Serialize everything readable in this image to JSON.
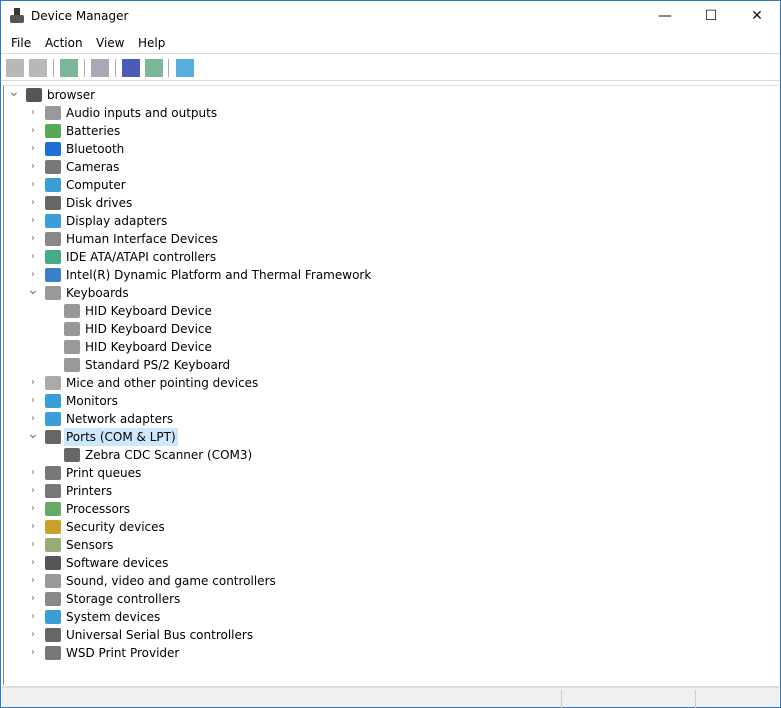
{
  "window": {
    "title": "Device Manager",
    "minimize": "—",
    "maximize": "☐",
    "close": "✕"
  },
  "menu": [
    "File",
    "Action",
    "View",
    "Help"
  ],
  "toolbar": [
    {
      "name": "back-icon",
      "color": "#888"
    },
    {
      "name": "forward-icon",
      "color": "#888"
    },
    {
      "name": "show-hide-console-tree-icon",
      "color": "#6a8"
    },
    {
      "name": "properties-icon",
      "color": "#99a"
    },
    {
      "name": "help-icon",
      "color": "#2a3fa8"
    },
    {
      "name": "run-icon",
      "color": "#6a8"
    },
    {
      "name": "scan-hardware-icon",
      "color": "#3a9fd8"
    }
  ],
  "tree": {
    "root": "browser",
    "items": [
      {
        "label": "Audio inputs and outputs",
        "color": "#999"
      },
      {
        "label": "Batteries",
        "color": "#5a5"
      },
      {
        "label": "Bluetooth",
        "color": "#1e6fd9"
      },
      {
        "label": "Cameras",
        "color": "#777"
      },
      {
        "label": "Computer",
        "color": "#3a9fd8"
      },
      {
        "label": "Disk drives",
        "color": "#666"
      },
      {
        "label": "Display adapters",
        "color": "#3a9fd8"
      },
      {
        "label": "Human Interface Devices",
        "color": "#888"
      },
      {
        "label": "IDE ATA/ATAPI controllers",
        "color": "#4a8"
      },
      {
        "label": "Intel(R) Dynamic Platform and Thermal Framework",
        "color": "#3a7fc8"
      },
      {
        "label": "Keyboards",
        "color": "#999",
        "expanded": true,
        "children": [
          "HID Keyboard Device",
          "HID Keyboard Device",
          "HID Keyboard Device",
          "Standard PS/2 Keyboard"
        ]
      },
      {
        "label": "Mice and other pointing devices",
        "color": "#aaa"
      },
      {
        "label": "Monitors",
        "color": "#3a9fd8"
      },
      {
        "label": "Network adapters",
        "color": "#3a9fd8"
      },
      {
        "label": "Ports (COM & LPT)",
        "color": "#666",
        "expanded": true,
        "selected": true,
        "children": [
          "Zebra CDC Scanner (COM3)"
        ]
      },
      {
        "label": "Print queues",
        "color": "#777"
      },
      {
        "label": "Printers",
        "color": "#777"
      },
      {
        "label": "Processors",
        "color": "#6a6"
      },
      {
        "label": "Security devices",
        "color": "#c9a227"
      },
      {
        "label": "Sensors",
        "color": "#9a7"
      },
      {
        "label": "Software devices",
        "color": "#555"
      },
      {
        "label": "Sound, video and game controllers",
        "color": "#999"
      },
      {
        "label": "Storage controllers",
        "color": "#888"
      },
      {
        "label": "System devices",
        "color": "#3a9fd8"
      },
      {
        "label": "Universal Serial Bus controllers",
        "color": "#666"
      },
      {
        "label": "WSD Print Provider",
        "color": "#777"
      }
    ]
  }
}
